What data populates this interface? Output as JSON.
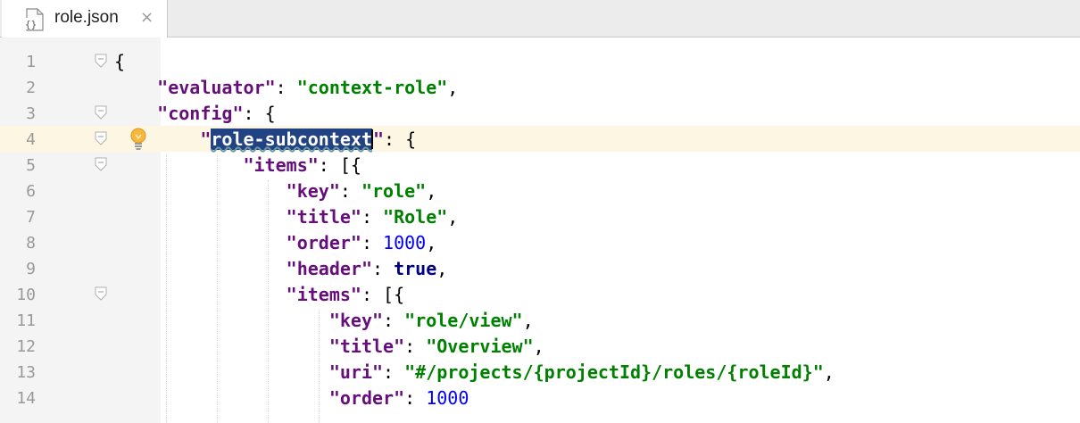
{
  "tab": {
    "icon": "json-file-icon",
    "label": "role.json",
    "close": "×"
  },
  "editor": {
    "current_line": 4,
    "lines": [
      {
        "n": "1"
      },
      {
        "n": "2"
      },
      {
        "n": "3"
      },
      {
        "n": "4"
      },
      {
        "n": "5"
      },
      {
        "n": "6"
      },
      {
        "n": "7"
      },
      {
        "n": "8"
      },
      {
        "n": "9"
      },
      {
        "n": "10"
      },
      {
        "n": "11"
      },
      {
        "n": "12"
      },
      {
        "n": "13"
      },
      {
        "n": "14"
      }
    ],
    "code": {
      "l1_brace": "{",
      "k_evaluator": "\"evaluator\"",
      "v_evaluator": "\"context-role\"",
      "k_config": "\"config\"",
      "q_open": "\"",
      "k_rolesub": "role-subcontext",
      "q_close": "\"",
      "k_items": "\"items\"",
      "k_key": "\"key\"",
      "v_key": "\"role\"",
      "k_title": "\"title\"",
      "v_title": "\"Role\"",
      "k_order": "\"order\"",
      "v_order": "1000",
      "k_header": "\"header\"",
      "v_header": "true",
      "k_items2": "\"items\"",
      "k_key2": "\"key\"",
      "v_key2": "\"role/view\"",
      "k_title2": "\"title\"",
      "v_title2": "\"Overview\"",
      "k_uri": "\"uri\"",
      "v_uri": "\"#/projects/{projectId}/roles/{roleId}\"",
      "k_order2": "\"order\"",
      "v_order2": "1000"
    }
  },
  "colors": {
    "key": "#660e7a",
    "string": "#008000",
    "number": "#0000ff",
    "keyword": "#000080",
    "selection": "#214283",
    "current_line": "#fdf6e2"
  }
}
